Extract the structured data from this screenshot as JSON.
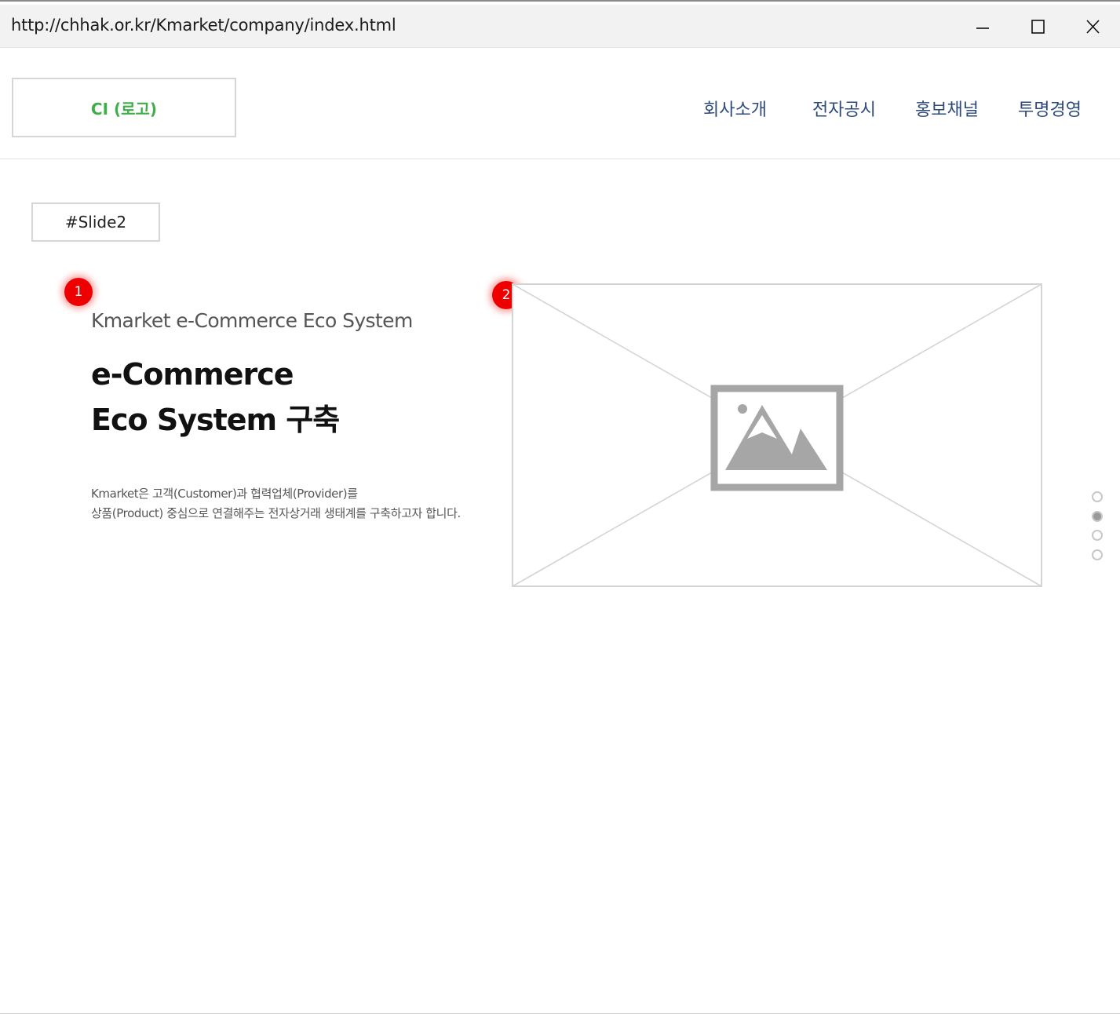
{
  "browser": {
    "url": "http://chhak.or.kr/Kmarket/company/index.html",
    "buttons": {
      "minimize": "minimize-icon",
      "maximize": "maximize-icon",
      "close": "close-icon"
    }
  },
  "header": {
    "logo_label": "CI (로고)",
    "nav": [
      {
        "label": "회사소개"
      },
      {
        "label": "전자공시"
      },
      {
        "label": "홍보채널"
      },
      {
        "label": "투명경영"
      }
    ]
  },
  "slide": {
    "tag": "#Slide2",
    "markers": [
      "1",
      "2"
    ],
    "subtitle": "Kmarket e-Commerce Eco System",
    "heading_line1": "e-Commerce",
    "heading_line2": "Eco System 구축",
    "desc_line1": "Kmarket은 고객(Customer)과 협력업체(Provider)를",
    "desc_line2": "상품(Product) 중심으로 연결해주는 전자상거래 생태계를 구축하고자 합니다.",
    "image": "image-placeholder-icon",
    "pager": {
      "count": 4,
      "active_index": 1
    }
  },
  "colors": {
    "logo_text": "#3fae49",
    "nav_text": "#2e4a7c",
    "marker": "#ee0000",
    "placeholder": "#a6a6a6"
  }
}
